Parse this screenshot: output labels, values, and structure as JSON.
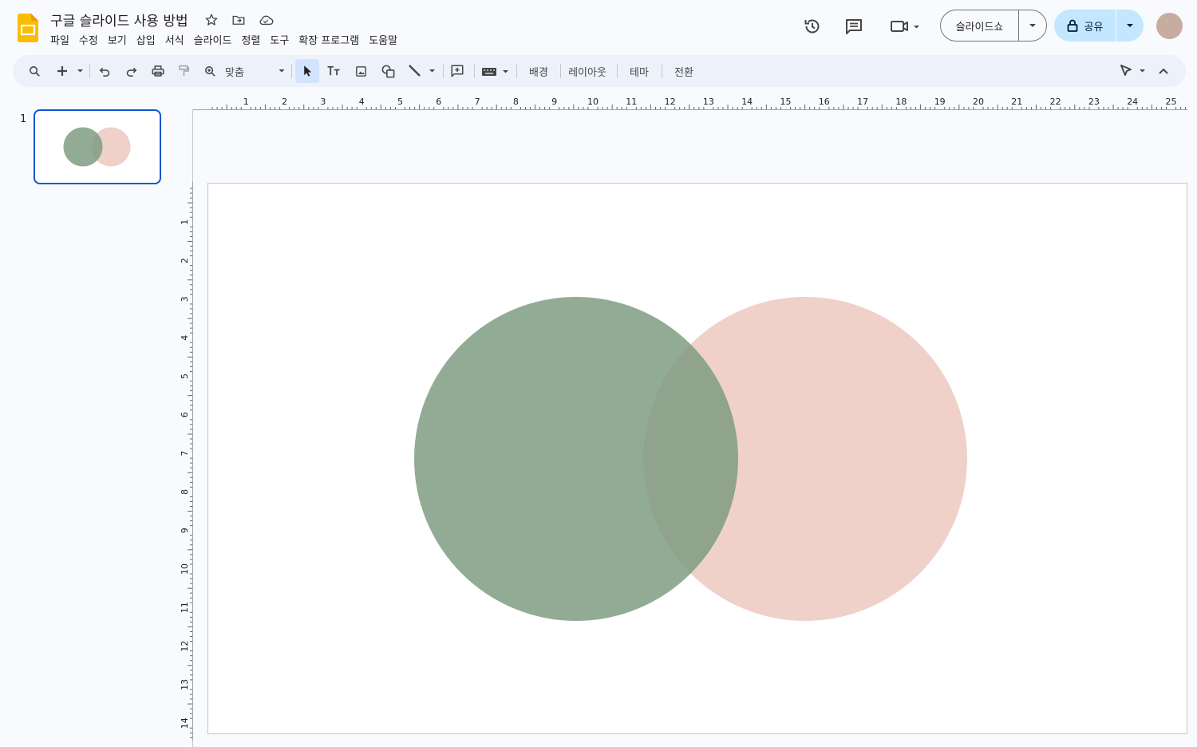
{
  "document": {
    "title": "구글 슬라이드 사용 방법"
  },
  "menu": [
    "파일",
    "수정",
    "보기",
    "삽입",
    "서식",
    "슬라이드",
    "정렬",
    "도구",
    "확장 프로그램",
    "도움말"
  ],
  "header_buttons": {
    "slideshow_label": "슬라이드쇼",
    "share_label": "공유"
  },
  "toolbar": {
    "zoom_label": "맞춤",
    "background_label": "배경",
    "layout_label": "레이아웃",
    "theme_label": "테마",
    "transition_label": "전환"
  },
  "filmstrip": {
    "slides": [
      {
        "number": "1"
      }
    ]
  },
  "rulers": {
    "horizontal": [
      "1",
      "2",
      "3",
      "4",
      "5",
      "6",
      "7",
      "8",
      "9",
      "10",
      "11",
      "12",
      "13",
      "14",
      "15",
      "16",
      "17",
      "18",
      "19",
      "20",
      "21",
      "22",
      "23",
      "24",
      "25"
    ],
    "vertical": [
      "1",
      "2",
      "3",
      "4",
      "5",
      "6",
      "7",
      "8",
      "9",
      "10",
      "11",
      "12",
      "13",
      "14"
    ]
  },
  "slide_content": {
    "shapes": [
      {
        "name": "green-circle",
        "fill": "#7f9c83",
        "opacity": 0.85
      },
      {
        "name": "pink-circle",
        "fill": "#ecc9c1",
        "opacity": 0.85
      }
    ]
  },
  "colors": {
    "accent": "#0b57d0",
    "share_bg": "#c2e7ff",
    "toolbar_bg": "#edf2fa",
    "logo": "#fbbc04"
  }
}
